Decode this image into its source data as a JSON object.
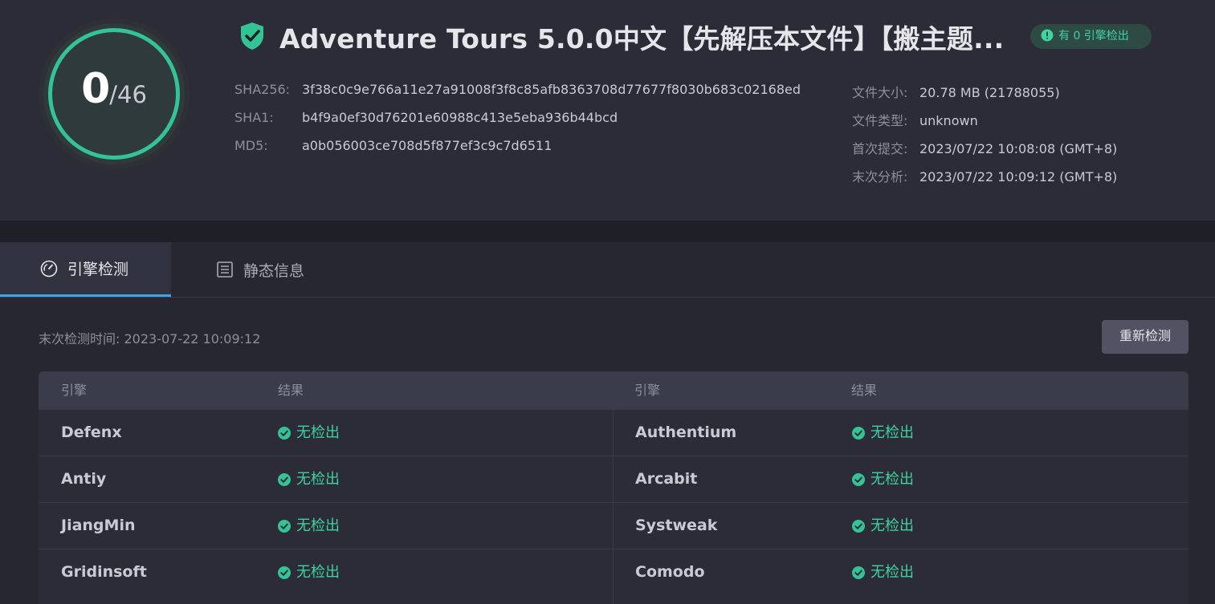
{
  "score": {
    "detected": "0",
    "total": "/46"
  },
  "title": "Adventure Tours 5.0.0中文【先解压本文件】【搬主题...",
  "badge": "有 0 引擎检出",
  "hashes": [
    {
      "label": "SHA256:",
      "value": "3f38c0c9e766a11e27a91008f3f8c85afb8363708d77677f8030b683c02168ed"
    },
    {
      "label": "SHA1:",
      "value": "b4f9a0ef30d76201e60988c413e5eba936b44bcd"
    },
    {
      "label": "MD5:",
      "value": "a0b056003ce708d5f877ef3c9c7d6511"
    }
  ],
  "meta": [
    {
      "label": "文件大小:",
      "value": "20.78 MB (21788055)"
    },
    {
      "label": "文件类型:",
      "value": "unknown"
    },
    {
      "label": "首次提交:",
      "value": "2023/07/22 10:08:08 (GMT+8)"
    },
    {
      "label": "末次分析:",
      "value": "2023/07/22 10:09:12 (GMT+8)"
    }
  ],
  "tabs": [
    {
      "label": "引擎检测",
      "icon": "gauge-icon"
    },
    {
      "label": "静态信息",
      "icon": "list-icon"
    }
  ],
  "last_scan": "末次检测时间: 2023-07-22 10:09:12",
  "rescan_label": "重新检测",
  "table": {
    "headers": [
      "引擎",
      "结果",
      "引擎",
      "结果"
    ],
    "rows": [
      {
        "left_engine": "Defenx",
        "left_result": "无检出",
        "right_engine": "Authentium",
        "right_result": "无检出"
      },
      {
        "left_engine": "Antiy",
        "left_result": "无检出",
        "right_engine": "Arcabit",
        "right_result": "无检出"
      },
      {
        "left_engine": "JiangMin",
        "left_result": "无检出",
        "right_engine": "Systweak",
        "right_result": "无检出"
      },
      {
        "left_engine": "Gridinsoft",
        "left_result": "无检出",
        "right_engine": "Comodo",
        "right_result": "无检出"
      }
    ]
  },
  "colors": {
    "accent_green": "#34c395",
    "tab_underline": "#3fa4e8"
  }
}
